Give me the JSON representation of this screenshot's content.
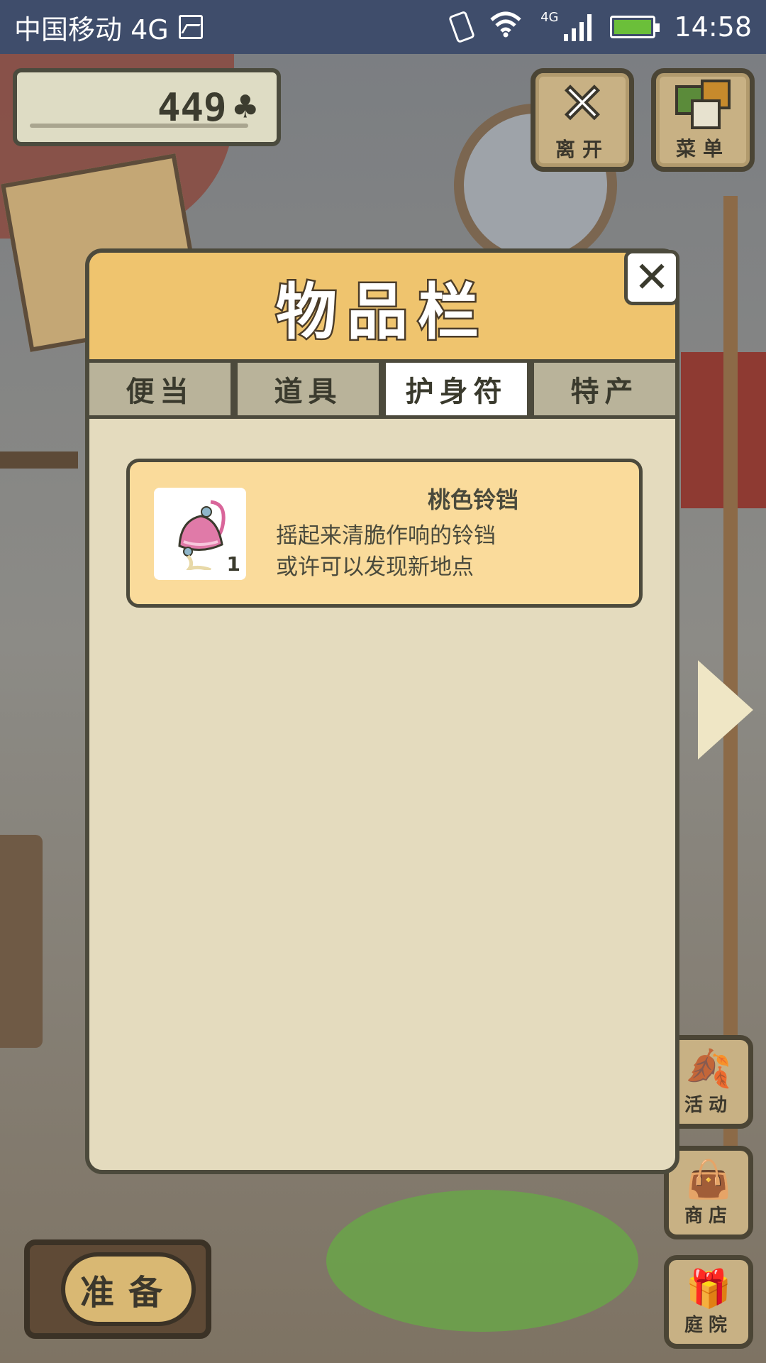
{
  "status_bar": {
    "carrier": "中国移动 4G",
    "network": "4G",
    "time": "14:58"
  },
  "currency": {
    "clover_count": "449",
    "icon": "clover-icon"
  },
  "top_buttons": {
    "leave_label": "离开",
    "menu_label": "菜单"
  },
  "side_buttons": {
    "event_label": "活动",
    "shop_label": "商店",
    "garden_label": "庭院"
  },
  "prepare_label": "准备",
  "inventory": {
    "title": "物品栏",
    "close_glyph": "✕",
    "tabs": [
      {
        "label": "便当",
        "active": false
      },
      {
        "label": "道具",
        "active": false
      },
      {
        "label": "护身符",
        "active": true
      },
      {
        "label": "特产",
        "active": false
      }
    ],
    "items": [
      {
        "name": "桃色铃铛",
        "desc_line1": "摇起来清脆作响的铃铛",
        "desc_line2": "或许可以发现新地点",
        "count": "1",
        "icon": "pink-bell-icon"
      }
    ]
  }
}
